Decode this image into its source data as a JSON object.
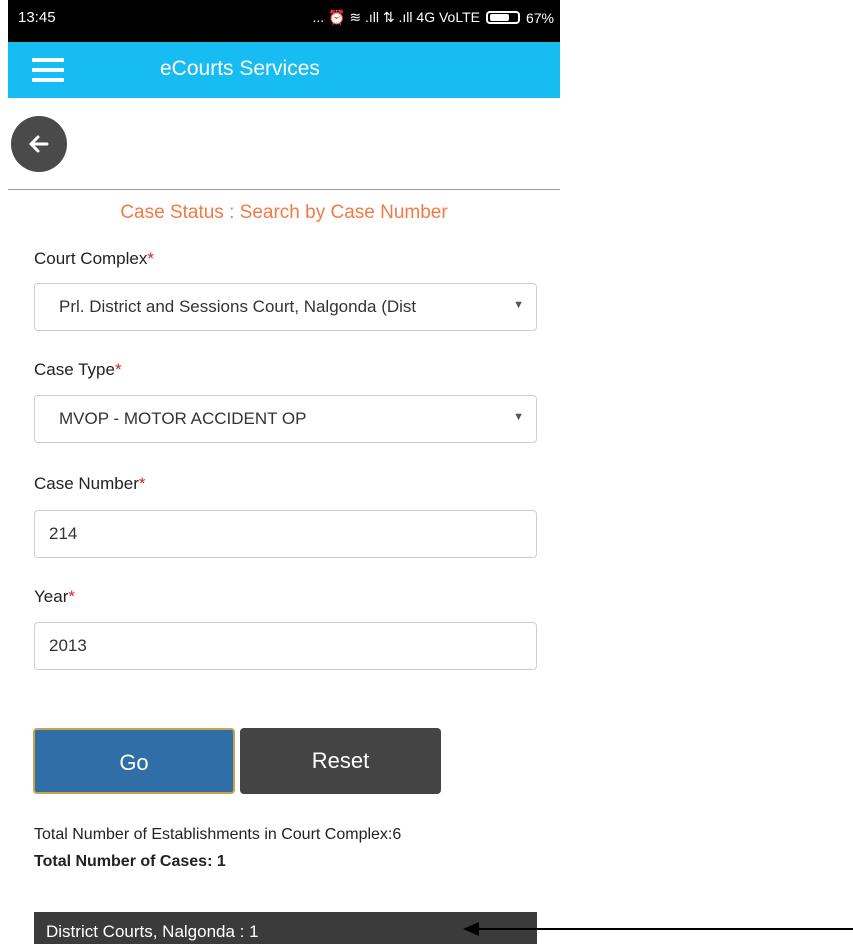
{
  "status_bar": {
    "time": "13:45",
    "icons_text": "... ⏰ ≋ .ıll ⇅ .ıll 4G VoLTE",
    "battery_percent": "67%"
  },
  "app_bar": {
    "title": "eCourts Services",
    "menu_icon": "hamburger-icon",
    "color": "#17bdf2"
  },
  "back_button": {
    "icon": "arrow-left-icon"
  },
  "form": {
    "heading": "Case Status : Search by Case Number",
    "court_complex": {
      "label": "Court Complex",
      "value": "Prl. District and Sessions Court, Nalgonda (Dist"
    },
    "case_type": {
      "label": "Case Type",
      "value": "MVOP - MOTOR ACCIDENT OP"
    },
    "case_number": {
      "label": "Case Number",
      "value": "214"
    },
    "year": {
      "label": "Year",
      "value": "2013"
    },
    "required_mark": "*",
    "dropdown_caret": "▼",
    "go_label": "Go",
    "reset_label": "Reset"
  },
  "results": {
    "establishments_text": "Total Number of Establishments in Court Complex:6",
    "cases_text": "Total Number of Cases: 1",
    "court_item": "District Courts, Nalgonda : 1"
  },
  "colors": {
    "heading": "#f07b47",
    "go_button": "#2f6ea7",
    "reset_button": "#444444",
    "required": "#d9221e"
  }
}
